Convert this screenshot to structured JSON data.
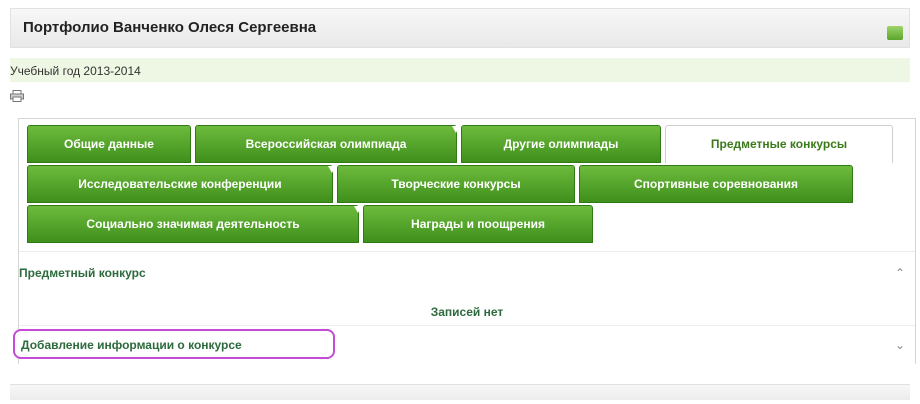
{
  "header": {
    "title": "Портфолио Ванченко Олеся Сергеевна"
  },
  "year": {
    "label": "Учебный год 2013-2014"
  },
  "tabs": [
    {
      "label": "Общие данные",
      "active": false
    },
    {
      "label": "Всероссийская олимпиада",
      "active": false
    },
    {
      "label": "Другие олимпиады",
      "active": false
    },
    {
      "label": "Предметные конкурсы",
      "active": true
    },
    {
      "label": "Исследовательские конференции",
      "active": false
    },
    {
      "label": "Творческие конкурсы",
      "active": false
    },
    {
      "label": "Спортивные соревнования",
      "active": false
    },
    {
      "label": "Социально значимая деятельность",
      "active": false
    },
    {
      "label": "Награды и поощрения",
      "active": false
    }
  ],
  "sections": {
    "subject_contest_title": "Предметный конкурс",
    "no_records": "Записей нет",
    "add_info_title": "Добавление информации о конкурсе"
  },
  "icons": {
    "print": "print-icon",
    "collapse": "chevron-up-icon",
    "expand": "chevron-down-icon",
    "status": "green-flag-icon"
  },
  "colors": {
    "tab_green": "#4a9a24",
    "highlight_purple": "#c44bd6",
    "link_green": "#2d6a3d"
  }
}
